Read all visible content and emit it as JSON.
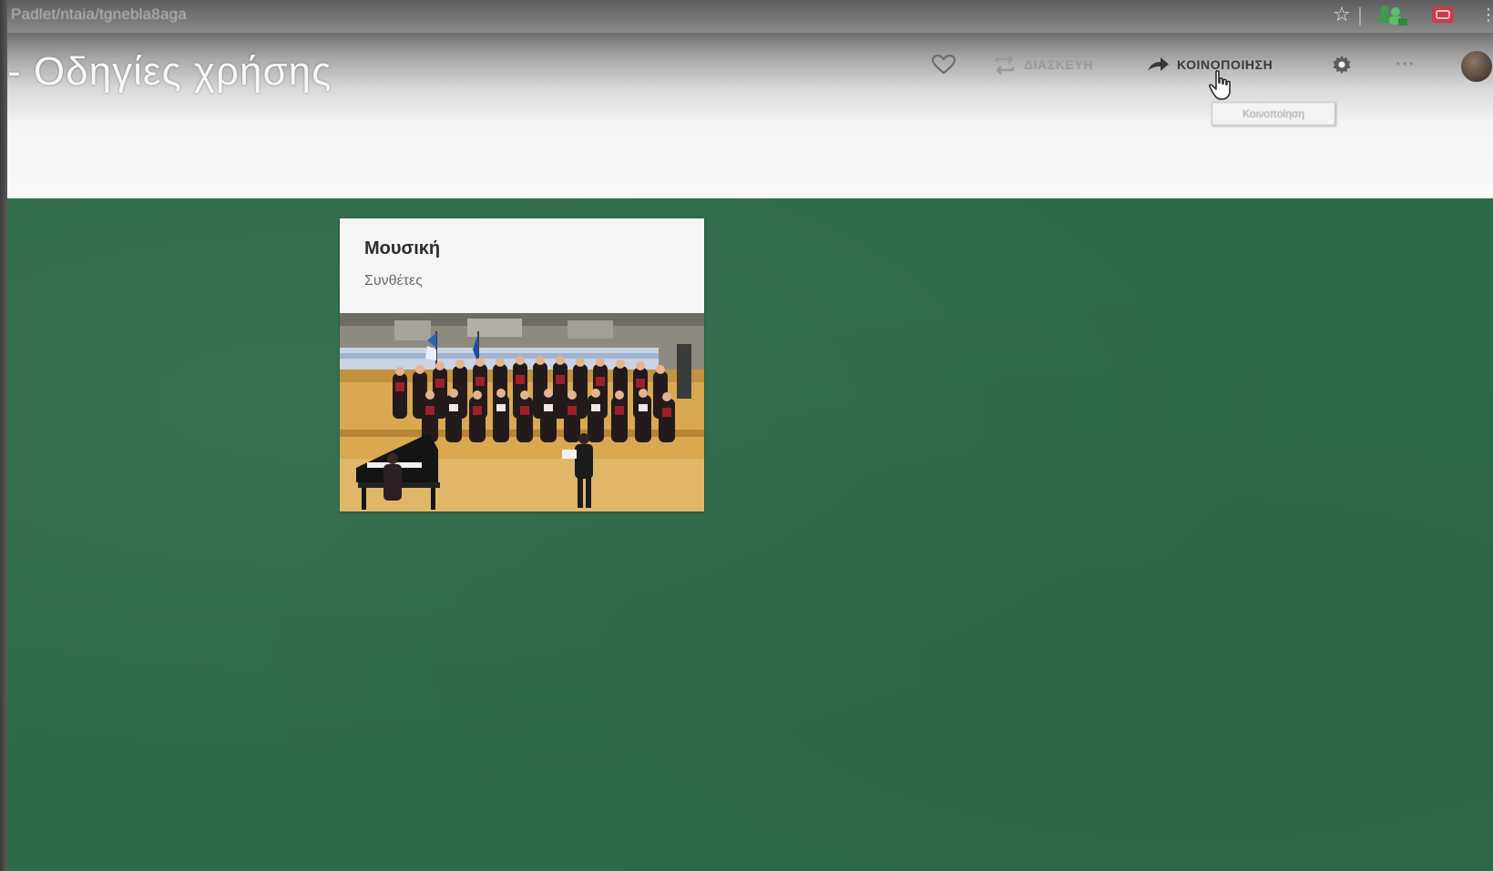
{
  "browser": {
    "url": "Padlet/ntaia/tgnebla8aga"
  },
  "header": {
    "title": "- Οδηγίες χρήσης",
    "actions": {
      "remix_label": "ΔΙΑΣΚΕΥΗ",
      "share_label": "ΚΟΙΝΟΠΟΙΗΣΗ",
      "more_label": "···"
    },
    "tooltip": "Κοινοποίηση"
  },
  "board": {
    "background_color": "#2e6a49",
    "posts": [
      {
        "title": "Μουσική",
        "body": "Συνθέτες"
      }
    ]
  },
  "icons": {
    "favorite": "heart-icon",
    "remix": "repeat-icon",
    "share": "share-arrow-icon",
    "settings": "gear-icon",
    "more": "ellipsis-icon",
    "cursor": "hand-pointer-icon"
  }
}
